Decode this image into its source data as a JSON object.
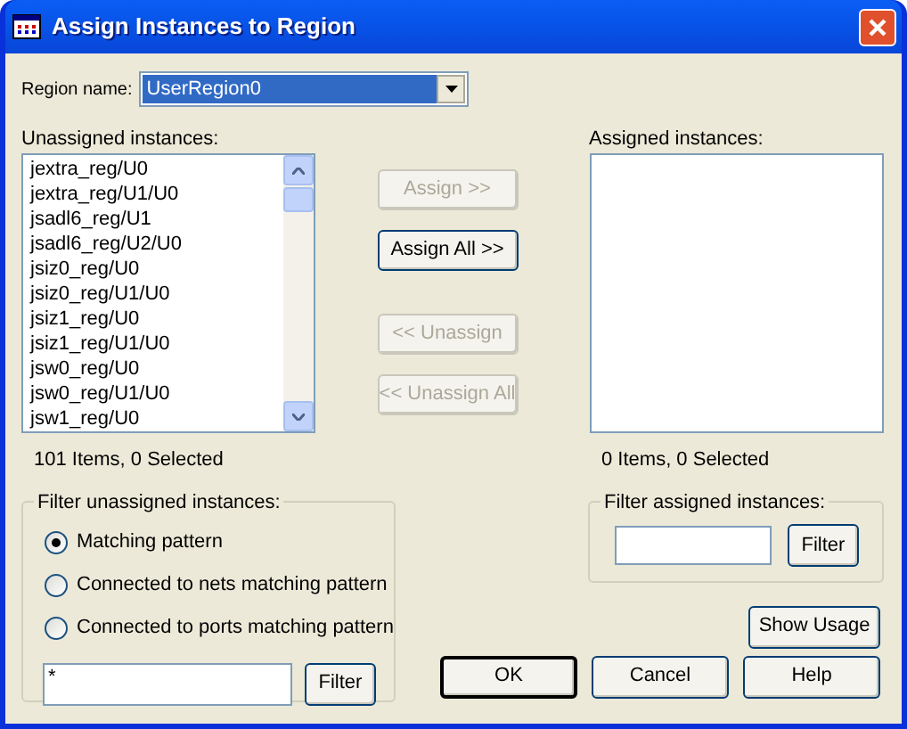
{
  "window": {
    "title": "Assign Instances to Region"
  },
  "region": {
    "label": "Region name:",
    "value": "UserRegion0"
  },
  "unassigned": {
    "label": "Unassigned instances:",
    "items": [
      "jextra_reg/U0",
      "jextra_reg/U1/U0",
      "jsadl6_reg/U1",
      "jsadl6_reg/U2/U0",
      "jsiz0_reg/U0",
      "jsiz0_reg/U1/U0",
      "jsiz1_reg/U0",
      "jsiz1_reg/U1/U0",
      "jsw0_reg/U0",
      "jsw0_reg/U1/U0",
      "jsw1_reg/U0"
    ],
    "status": "101 Items, 0 Selected"
  },
  "transfer_buttons": [
    {
      "label": "Assign >>",
      "disabled": true
    },
    {
      "label": "Assign All >>",
      "disabled": false
    },
    {
      "label": "<< Unassign",
      "disabled": true
    },
    {
      "label": "<< Unassign All",
      "disabled": true
    }
  ],
  "assigned": {
    "label": "Assigned instances:",
    "status": "0 Items, 0 Selected"
  },
  "filter_unassigned": {
    "title": "Filter unassigned instances:",
    "options": [
      {
        "label": "Matching pattern",
        "selected": true
      },
      {
        "label": "Connected to nets matching pattern",
        "selected": false
      },
      {
        "label": "Connected to ports matching pattern",
        "selected": false
      }
    ],
    "value": "*",
    "button": "Filter"
  },
  "filter_assigned": {
    "title": "Filter assigned instances:",
    "button": "Filter"
  },
  "show_usage": "Show Usage",
  "buttons": [
    {
      "label": "OK",
      "default": true
    },
    {
      "label": "Cancel",
      "default": false
    },
    {
      "label": "Help",
      "default": false
    }
  ]
}
